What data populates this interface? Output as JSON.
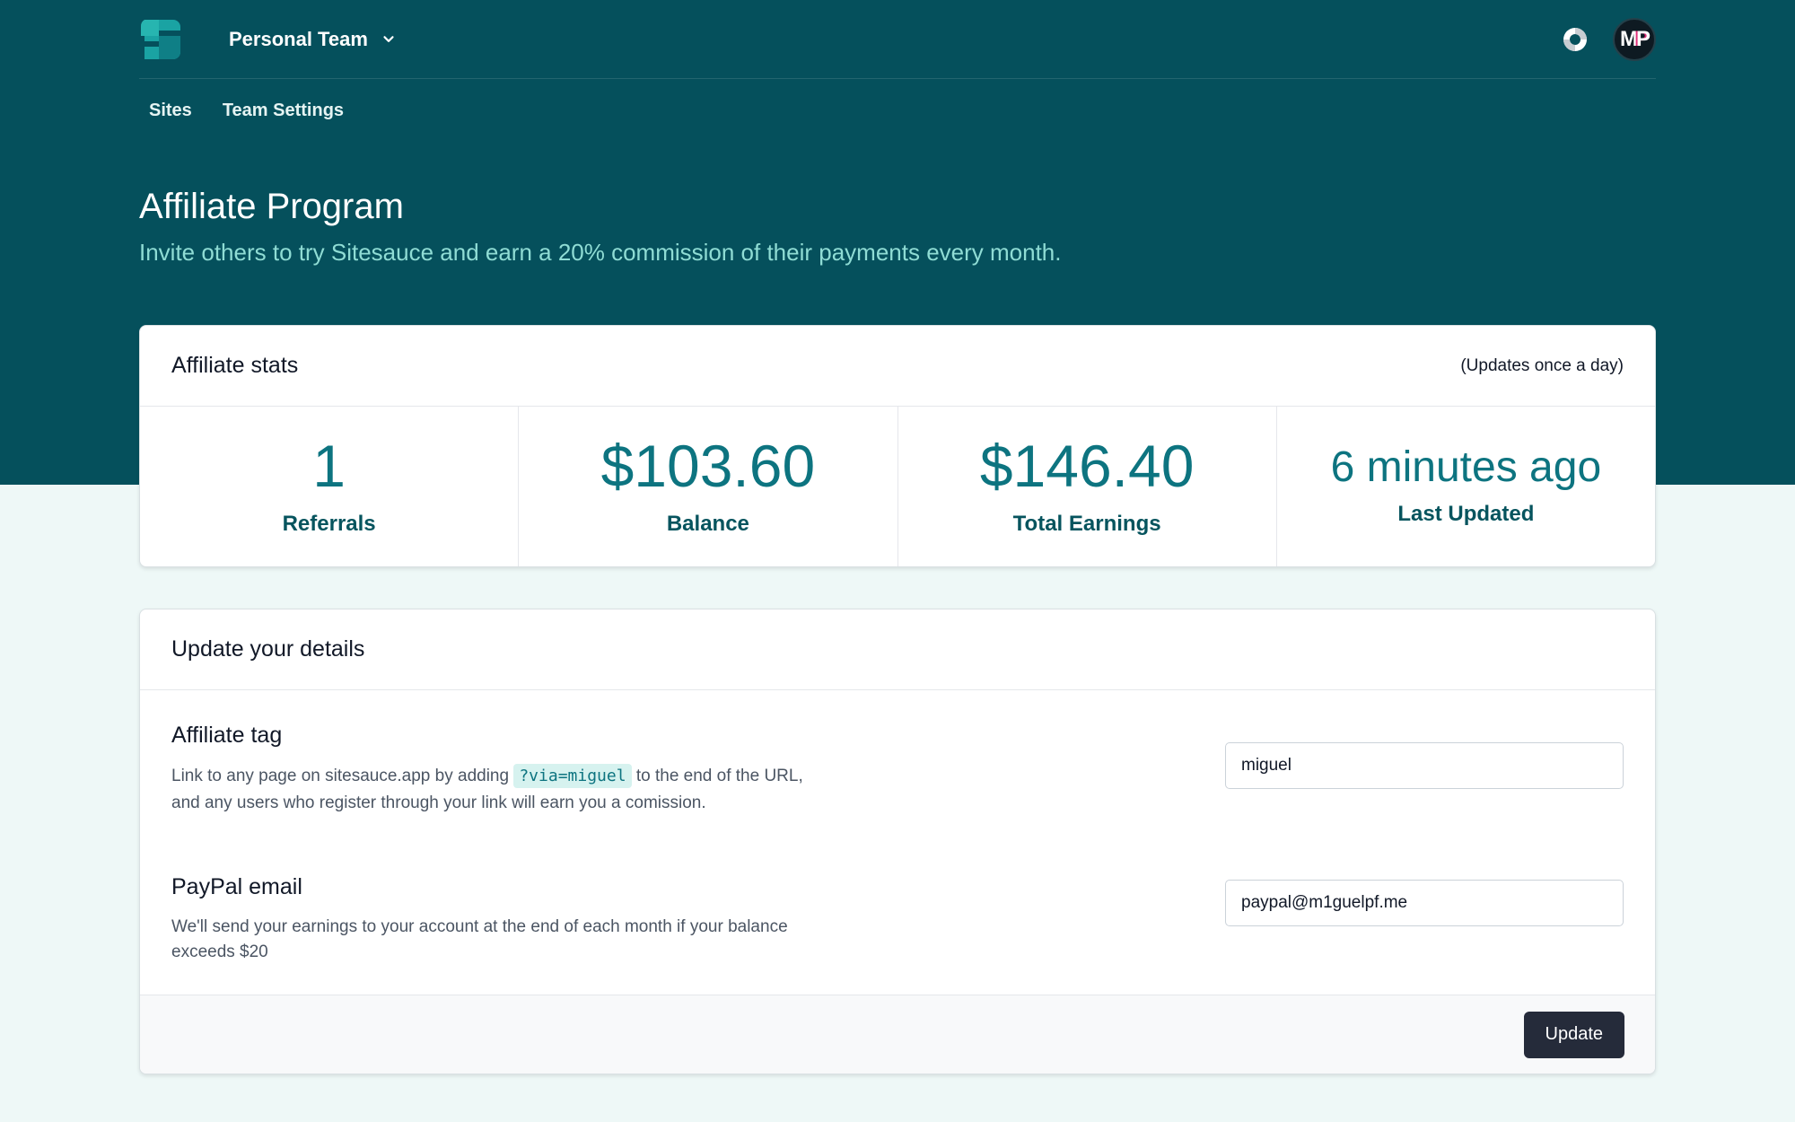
{
  "header": {
    "team_name": "Personal Team",
    "avatar_initials_m": "M",
    "avatar_initials_p": "P"
  },
  "nav": {
    "items": [
      {
        "label": "Sites"
      },
      {
        "label": "Team Settings"
      }
    ]
  },
  "page": {
    "title": "Affiliate Program",
    "subtitle": "Invite others to try Sitesauce and earn a 20% commission of their payments every month."
  },
  "stats_card": {
    "title": "Affiliate stats",
    "note": "(Updates once a day)",
    "stats": [
      {
        "value": "1",
        "label": "Referrals"
      },
      {
        "value": "$103.60",
        "label": "Balance"
      },
      {
        "value": "$146.40",
        "label": "Total Earnings"
      },
      {
        "value": "6 minutes ago",
        "label": "Last Updated"
      }
    ]
  },
  "details_card": {
    "title": "Update your details",
    "affiliate_tag": {
      "heading": "Affiliate tag",
      "desc_before": "Link to any page on sitesauce.app by adding",
      "code": "?via=miguel",
      "desc_after": "to the end of the URL,",
      "desc_line2": "and any users who register through your link will earn you a comission.",
      "value": "miguel"
    },
    "paypal": {
      "heading": "PayPal email",
      "desc_line1": "We'll send your earnings to your account at the end of each month if your balance",
      "desc_line2": "exceeds $20",
      "value": "paypal@m1guelpf.me"
    },
    "submit_label": "Update"
  },
  "colors": {
    "hero_bg": "#05505c",
    "accent": "#0d7480",
    "subtitle": "#8fdcd4",
    "button_bg": "#252b3a"
  },
  "icons": [
    "sitesauce-logo-icon",
    "chevron-down-icon",
    "lifebuoy-icon"
  ]
}
